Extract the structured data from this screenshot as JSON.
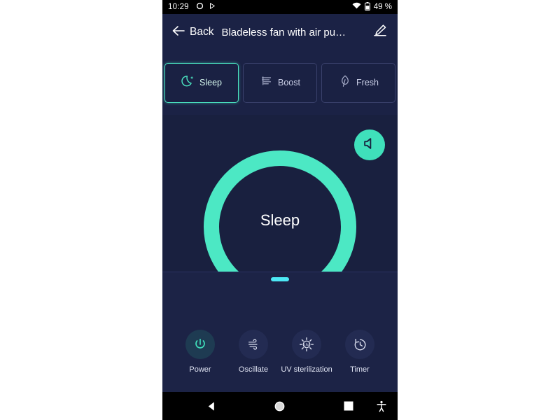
{
  "status_bar": {
    "clock": "10:29",
    "battery_text": "49 %",
    "icons": [
      "record-circle-icon",
      "play-store-icon",
      "wifi-icon",
      "battery-icon"
    ]
  },
  "header": {
    "back_label": "Back",
    "title": "Bladeless fan with air pu…",
    "edit_icon": "pencil-edit-icon",
    "back_icon": "arrow-left-icon"
  },
  "modes": [
    {
      "label": "Sleep",
      "icon": "moon-star-icon",
      "active": true
    },
    {
      "label": "Boost",
      "icon": "wind-lines-icon",
      "active": false
    },
    {
      "label": "Fresh",
      "icon": "leaf-icon",
      "active": false
    }
  ],
  "dial": {
    "value_label": "Sleep",
    "ring_color": "#4ce8c4",
    "ring_background": "#19203f",
    "speaker_icon": "speaker-mute-icon",
    "speaker_button_color": "#3fe0bb"
  },
  "panel": {
    "drag_handle_color": "#4de8f5"
  },
  "controls": [
    {
      "label": "Power",
      "icon": "power-icon",
      "active": true
    },
    {
      "label": "Oscillate",
      "icon": "oscillate-wind-icon",
      "active": false
    },
    {
      "label": "UV sterilization",
      "icon": "uv-sun-icon",
      "active": false
    },
    {
      "label": "Timer",
      "icon": "timer-clock-icon",
      "active": false
    }
  ],
  "nav_bar": {
    "back": "nav-back-triangle",
    "home": "nav-home-circle",
    "recents": "nav-recents-square",
    "accessibility": "nav-accessibility-icon"
  },
  "colors": {
    "background": "#141a33",
    "appbar": "#1b2245",
    "dial_zone": "#19203f",
    "lower_panel": "#1c2346",
    "accent": "#4ce8c4",
    "text_primary": "#ffffff"
  }
}
